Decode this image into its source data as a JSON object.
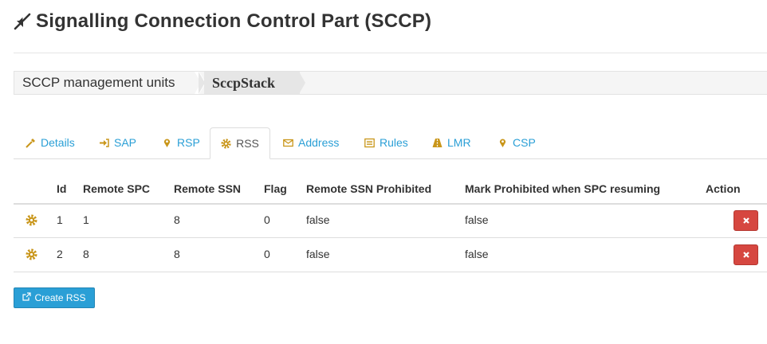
{
  "page": {
    "title": "Signalling Connection Control Part (SCCP)"
  },
  "breadcrumb": [
    "SCCP management units",
    "SccpStack"
  ],
  "tabs": [
    {
      "label": "Details",
      "icon": "wand-icon",
      "active": false
    },
    {
      "label": "SAP",
      "icon": "sign-in-icon",
      "active": false
    },
    {
      "label": "RSP",
      "icon": "map-marker-icon",
      "active": false
    },
    {
      "label": "RSS",
      "icon": "gear-icon",
      "active": true
    },
    {
      "label": "Address",
      "icon": "envelope-icon",
      "active": false
    },
    {
      "label": "Rules",
      "icon": "list-alt-icon",
      "active": false
    },
    {
      "label": "LMR",
      "icon": "road-icon",
      "active": false
    },
    {
      "label": "CSP",
      "icon": "map-marker-icon",
      "active": false
    }
  ],
  "table": {
    "headers": [
      "Id",
      "Remote SPC",
      "Remote SSN",
      "Flag",
      "Remote SSN Prohibited",
      "Mark Prohibited when SPC resuming",
      "Action"
    ],
    "rows": [
      [
        "1",
        "1",
        "8",
        "0",
        "false",
        "false"
      ],
      [
        "2",
        "8",
        "8",
        "0",
        "false",
        "false"
      ]
    ]
  },
  "create_button": "Create RSS",
  "colors": {
    "link": "#2a9fd6",
    "icon": "#c9961a",
    "danger": "#d64740",
    "primary": "#2a9fd6"
  }
}
